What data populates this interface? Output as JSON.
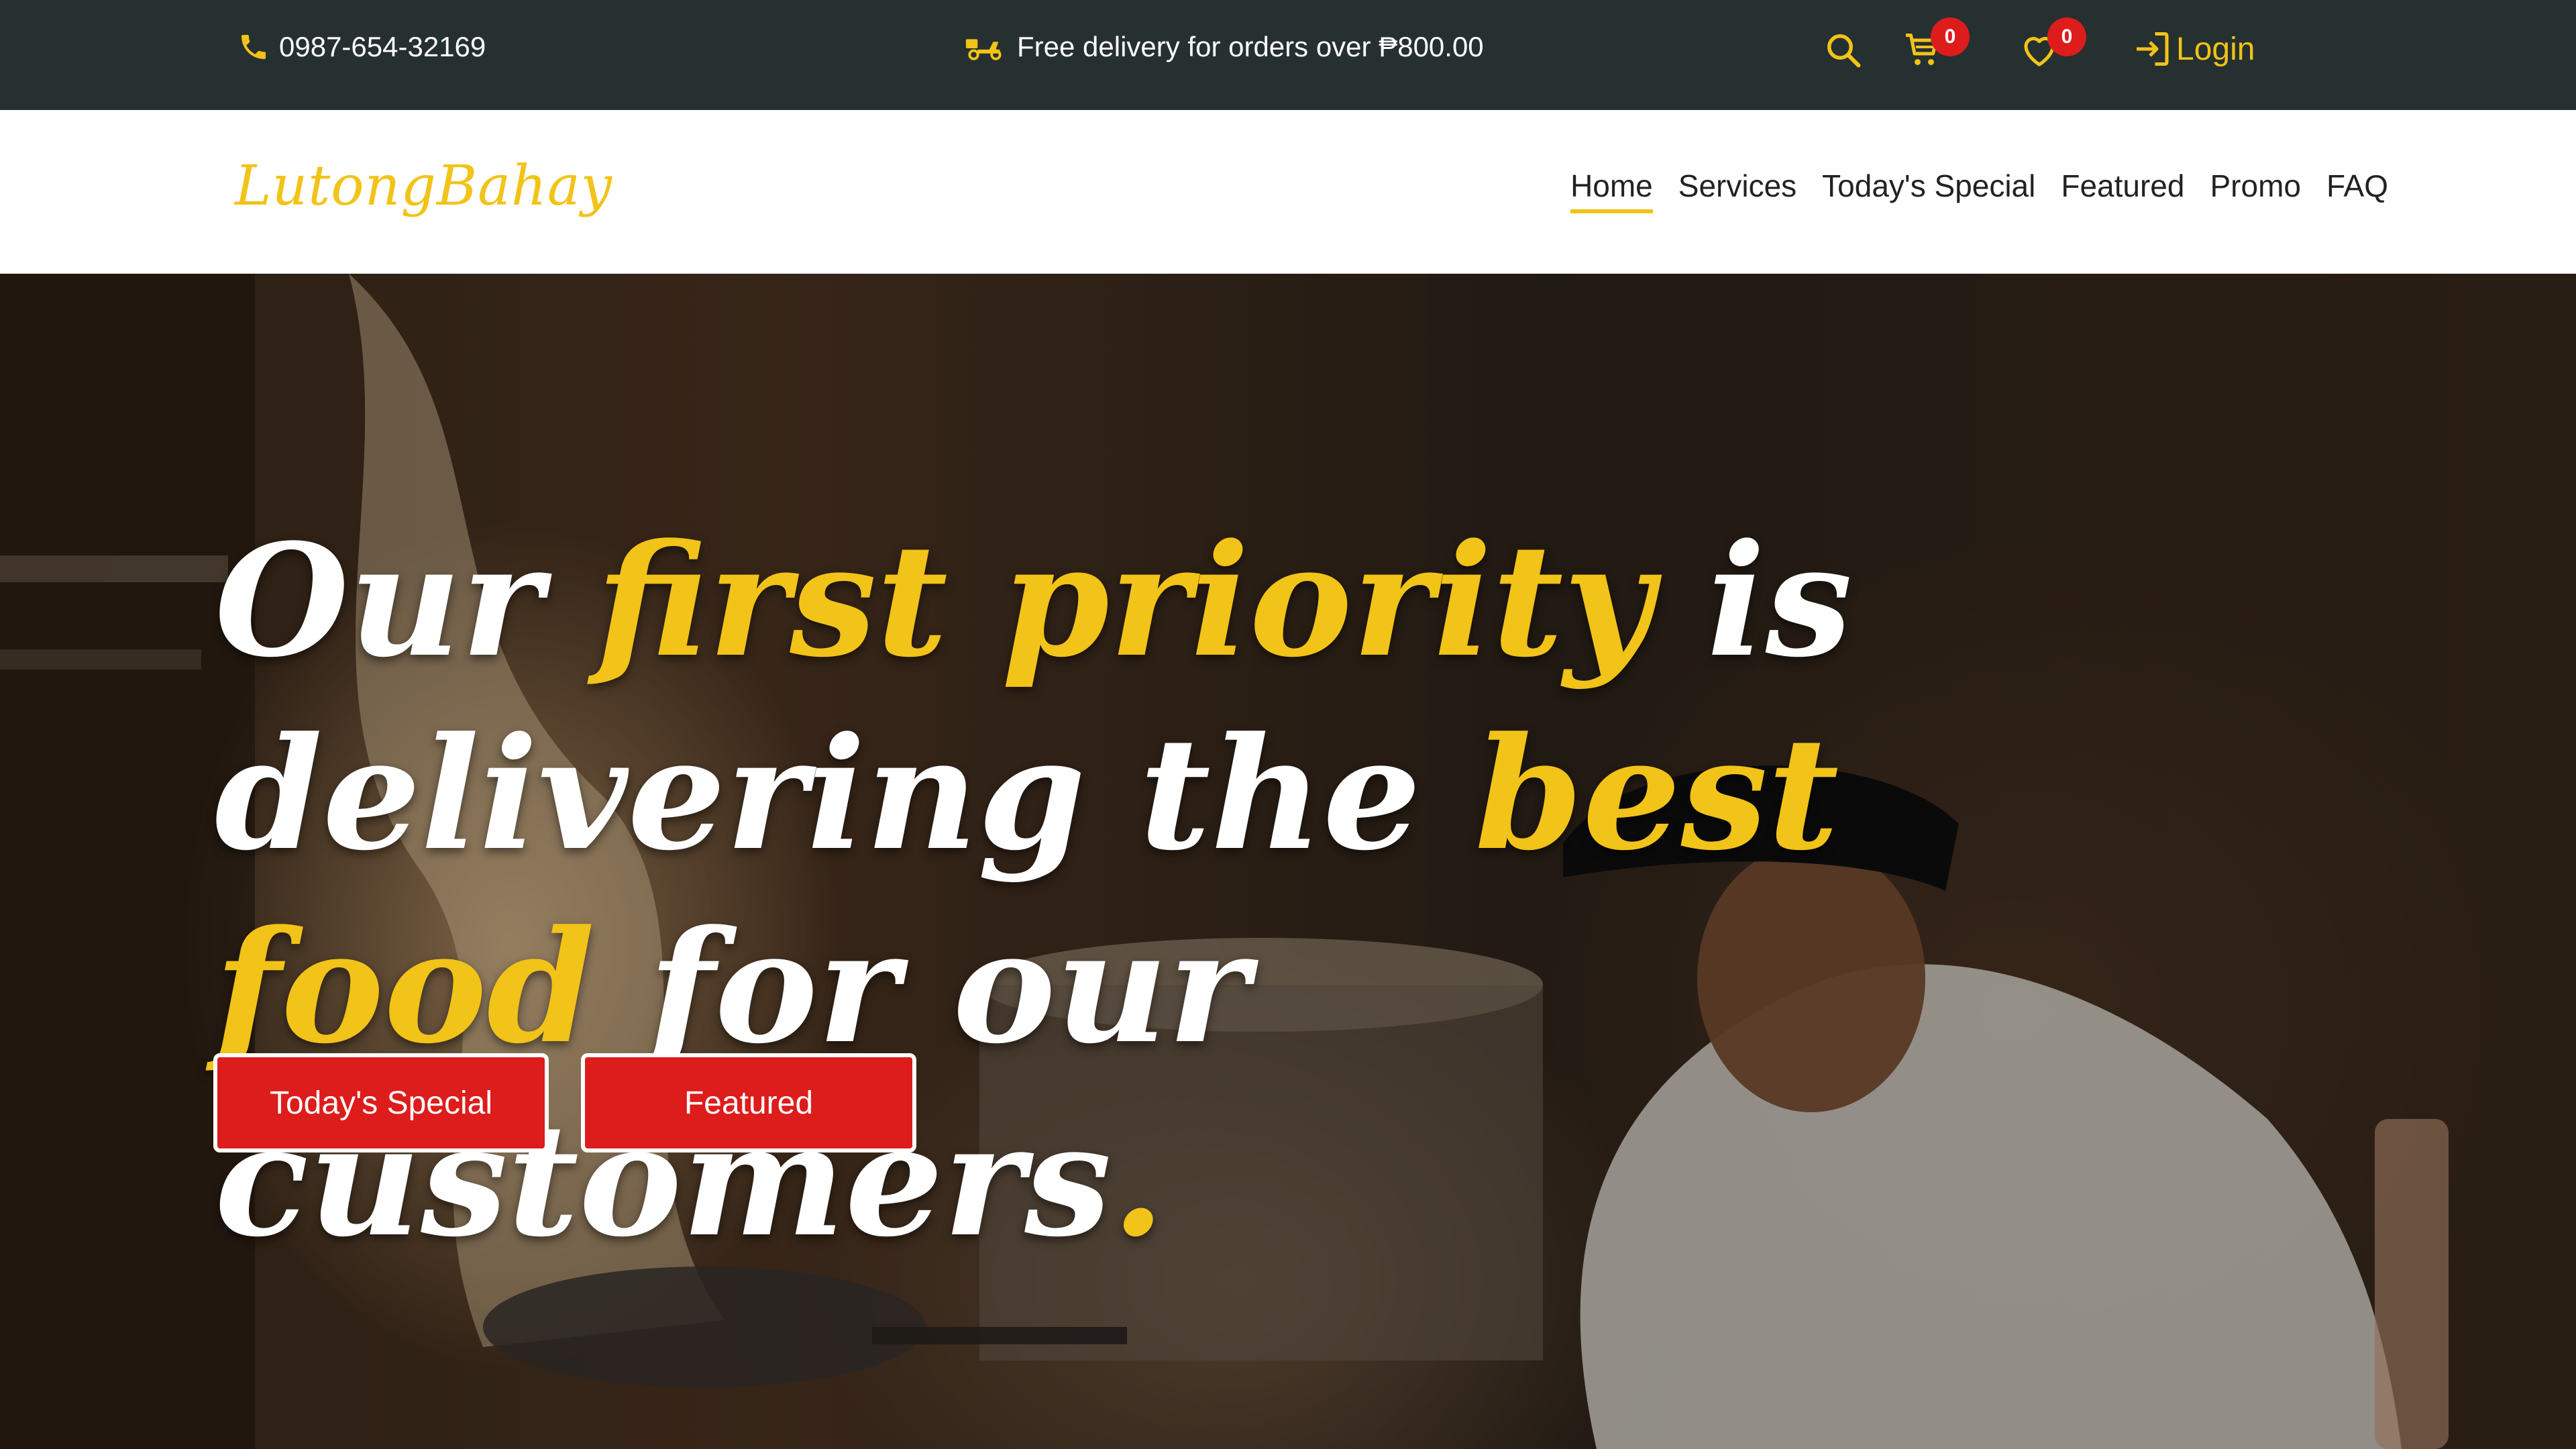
{
  "topbar": {
    "phone": "0987-654-32169",
    "delivery_text": "Free delivery for orders over ₱800.00",
    "cart_count": "0",
    "wishlist_count": "0",
    "login_label": "Login"
  },
  "navbar": {
    "brand": "LutongBahay",
    "menu": [
      "Home",
      "Services",
      "Today's Special",
      "Featured",
      "Promo",
      "FAQ"
    ],
    "active": "Home"
  },
  "hero": {
    "headline": {
      "w1": "Our",
      "h1": "first priority",
      "w2": "is delivering",
      "w3": "the",
      "h2": "best food",
      "w4": "for our",
      "w5": "customers",
      "h3": "."
    },
    "buttons": {
      "special": "Today's Special",
      "featured": "Featured"
    }
  },
  "colors": {
    "accent": "#f2c318",
    "button_red": "#dd1c1c",
    "topbar_bg": "#263030",
    "badge_red": "#dd1c1c"
  },
  "icons": [
    "phone-icon",
    "scooter-icon",
    "search-icon",
    "cart-icon",
    "heart-icon",
    "login-icon"
  ]
}
